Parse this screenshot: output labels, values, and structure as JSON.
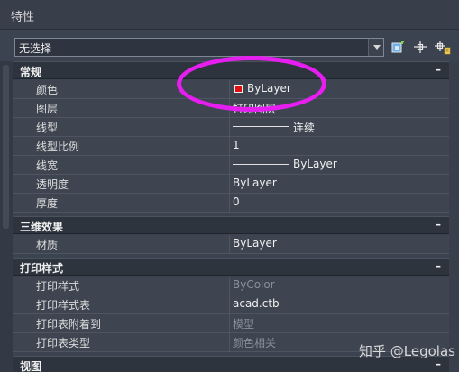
{
  "panel": {
    "title": "特性"
  },
  "selector": {
    "value": "无选择"
  },
  "toolbar_icons": [
    "quick-select-icon",
    "select-objects-icon",
    "toggle-pickadd-icon"
  ],
  "colors": {
    "accent_annotation": "#e61ef0",
    "swatch_red": "#e01010"
  },
  "sections": [
    {
      "label": "常规",
      "toggle": "–",
      "rows": [
        {
          "key": "颜色",
          "value": "ByLayer",
          "swatch": true
        },
        {
          "key": "图层",
          "value": "打印图层"
        },
        {
          "key": "线型",
          "value": "连续",
          "line": true
        },
        {
          "key": "线型比例",
          "value": "1"
        },
        {
          "key": "线宽",
          "value": "ByLayer",
          "line": true
        },
        {
          "key": "透明度",
          "value": "ByLayer"
        },
        {
          "key": "厚度",
          "value": "0"
        }
      ]
    },
    {
      "label": "三维效果",
      "toggle": "–",
      "rows": [
        {
          "key": "材质",
          "value": "ByLayer"
        }
      ]
    },
    {
      "label": "打印样式",
      "toggle": "–",
      "rows": [
        {
          "key": "打印样式",
          "value": "ByColor",
          "gray": true
        },
        {
          "key": "打印样式表",
          "value": "acad.ctb"
        },
        {
          "key": "打印表附着到",
          "value": "模型",
          "gray": true
        },
        {
          "key": "打印表类型",
          "value": "颜色相关",
          "gray": true
        }
      ]
    },
    {
      "label": "视图",
      "toggle": "–",
      "rows": []
    }
  ],
  "watermark": "知乎 @Legolas"
}
